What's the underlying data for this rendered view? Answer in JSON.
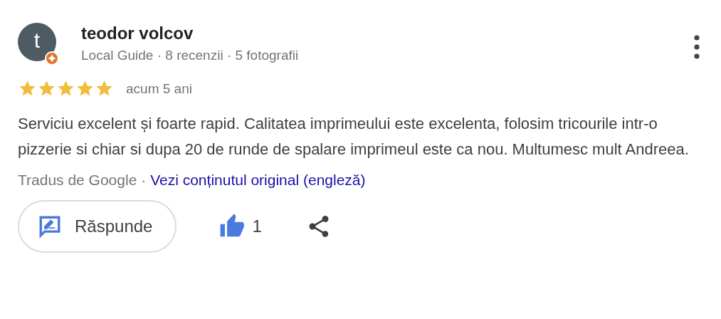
{
  "review": {
    "author": {
      "initial": "t",
      "name": "teodor volcov",
      "meta": "Local Guide · 8 recenzii · 5 fotografii"
    },
    "stars": 5,
    "time": "acum 5 ani",
    "text": "Serviciu excelent și foarte rapid. Calitatea imprimeului este excelenta, folosim tricourile intr-o pizzerie si chiar si dupa 20 de runde de spalare imprimeul este ca nou. Multumesc mult Andreea.",
    "translation": {
      "label": "Tradus de Google ·",
      "link": "Vezi conținutul original (engleză)"
    },
    "actions": {
      "reply": "Răspunde",
      "likes": "1"
    }
  }
}
